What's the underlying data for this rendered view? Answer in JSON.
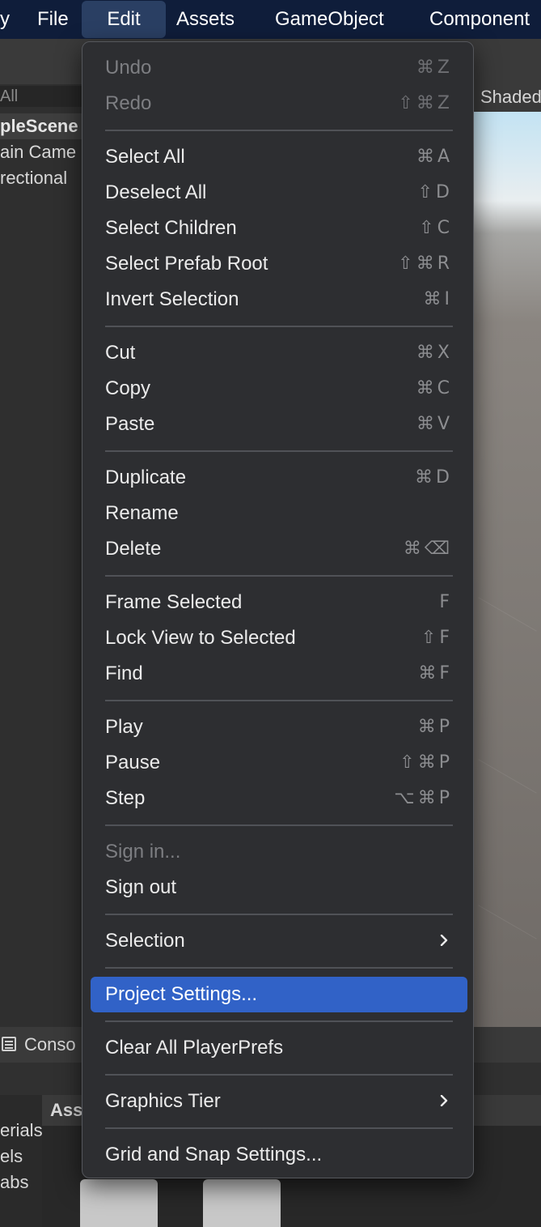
{
  "menubar": {
    "items": [
      {
        "label": "y"
      },
      {
        "label": "File"
      },
      {
        "label": "Edit"
      },
      {
        "label": "Assets"
      },
      {
        "label": "GameObject"
      },
      {
        "label": "Component"
      }
    ]
  },
  "hierarchy": {
    "search_text": "All",
    "scene_name": "pleScene",
    "rows": [
      "ain Came",
      "rectional"
    ]
  },
  "scene_view": {
    "shading_mode": "Shaded"
  },
  "console": {
    "tab_label": "Conso"
  },
  "project": {
    "folders": [
      "erials",
      "els",
      "abs"
    ],
    "assets_header": "Ass"
  },
  "edit_menu": {
    "groups": [
      [
        {
          "label": "Undo",
          "shortcut": "⌘Z",
          "disabled": true
        },
        {
          "label": "Redo",
          "shortcut": "⇧⌘Z",
          "disabled": true
        }
      ],
      [
        {
          "label": "Select All",
          "shortcut": "⌘A"
        },
        {
          "label": "Deselect All",
          "shortcut": "⇧D"
        },
        {
          "label": "Select Children",
          "shortcut": "⇧C"
        },
        {
          "label": "Select Prefab Root",
          "shortcut": "⇧⌘R"
        },
        {
          "label": "Invert Selection",
          "shortcut": "⌘I"
        }
      ],
      [
        {
          "label": "Cut",
          "shortcut": "⌘X"
        },
        {
          "label": "Copy",
          "shortcut": "⌘C"
        },
        {
          "label": "Paste",
          "shortcut": "⌘V"
        }
      ],
      [
        {
          "label": "Duplicate",
          "shortcut": "⌘D"
        },
        {
          "label": "Rename",
          "shortcut": ""
        },
        {
          "label": "Delete",
          "shortcut": "⌘⌫"
        }
      ],
      [
        {
          "label": "Frame Selected",
          "shortcut": "F"
        },
        {
          "label": "Lock View to Selected",
          "shortcut": "⇧F"
        },
        {
          "label": "Find",
          "shortcut": "⌘F"
        }
      ],
      [
        {
          "label": "Play",
          "shortcut": "⌘P"
        },
        {
          "label": "Pause",
          "shortcut": "⇧⌘P"
        },
        {
          "label": "Step",
          "shortcut": "⌥⌘P"
        }
      ],
      [
        {
          "label": "Sign in...",
          "shortcut": "",
          "disabled": true
        },
        {
          "label": "Sign out",
          "shortcut": ""
        }
      ],
      [
        {
          "label": "Selection",
          "submenu": true
        }
      ],
      [
        {
          "label": "Project Settings...",
          "highlighted": true
        }
      ],
      [
        {
          "label": "Clear All PlayerPrefs"
        }
      ],
      [
        {
          "label": "Graphics Tier",
          "submenu": true
        }
      ],
      [
        {
          "label": "Grid and Snap Settings..."
        }
      ]
    ]
  },
  "colors": {
    "menubar_bg": "#0f1d3a",
    "menu_bg": "#2d2e31",
    "highlight": "#3162c7",
    "disabled_text": "#7d7e82"
  }
}
